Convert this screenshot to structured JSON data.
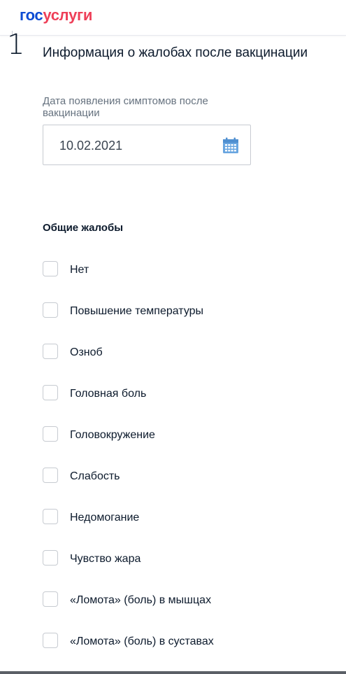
{
  "header": {
    "logo_part1": "гос",
    "logo_part2": "услуги"
  },
  "step": {
    "number": "1",
    "title": "Информация о жалобах после вакцинации"
  },
  "date_field": {
    "label": "Дата появления симптомов после вакцинации",
    "value": "10.02.2021",
    "icon": "calendar-icon"
  },
  "complaints": {
    "title": "Общие жалобы",
    "items": [
      {
        "label": "Нет",
        "checked": false
      },
      {
        "label": "Повышение температуры",
        "checked": false
      },
      {
        "label": "Озноб",
        "checked": false
      },
      {
        "label": "Головная боль",
        "checked": false
      },
      {
        "label": "Головокружение",
        "checked": false
      },
      {
        "label": "Слабость",
        "checked": false
      },
      {
        "label": "Недомогание",
        "checked": false
      },
      {
        "label": "Чувство жара",
        "checked": false
      },
      {
        "label": "«Ломота» (боль) в мышцах",
        "checked": false
      },
      {
        "label": "«Ломота» (боль) в суставах",
        "checked": false
      }
    ]
  },
  "colors": {
    "brand_blue": "#0d4cd3",
    "brand_red": "#ee3f58",
    "calendar_blue": "#6aa6e0"
  }
}
